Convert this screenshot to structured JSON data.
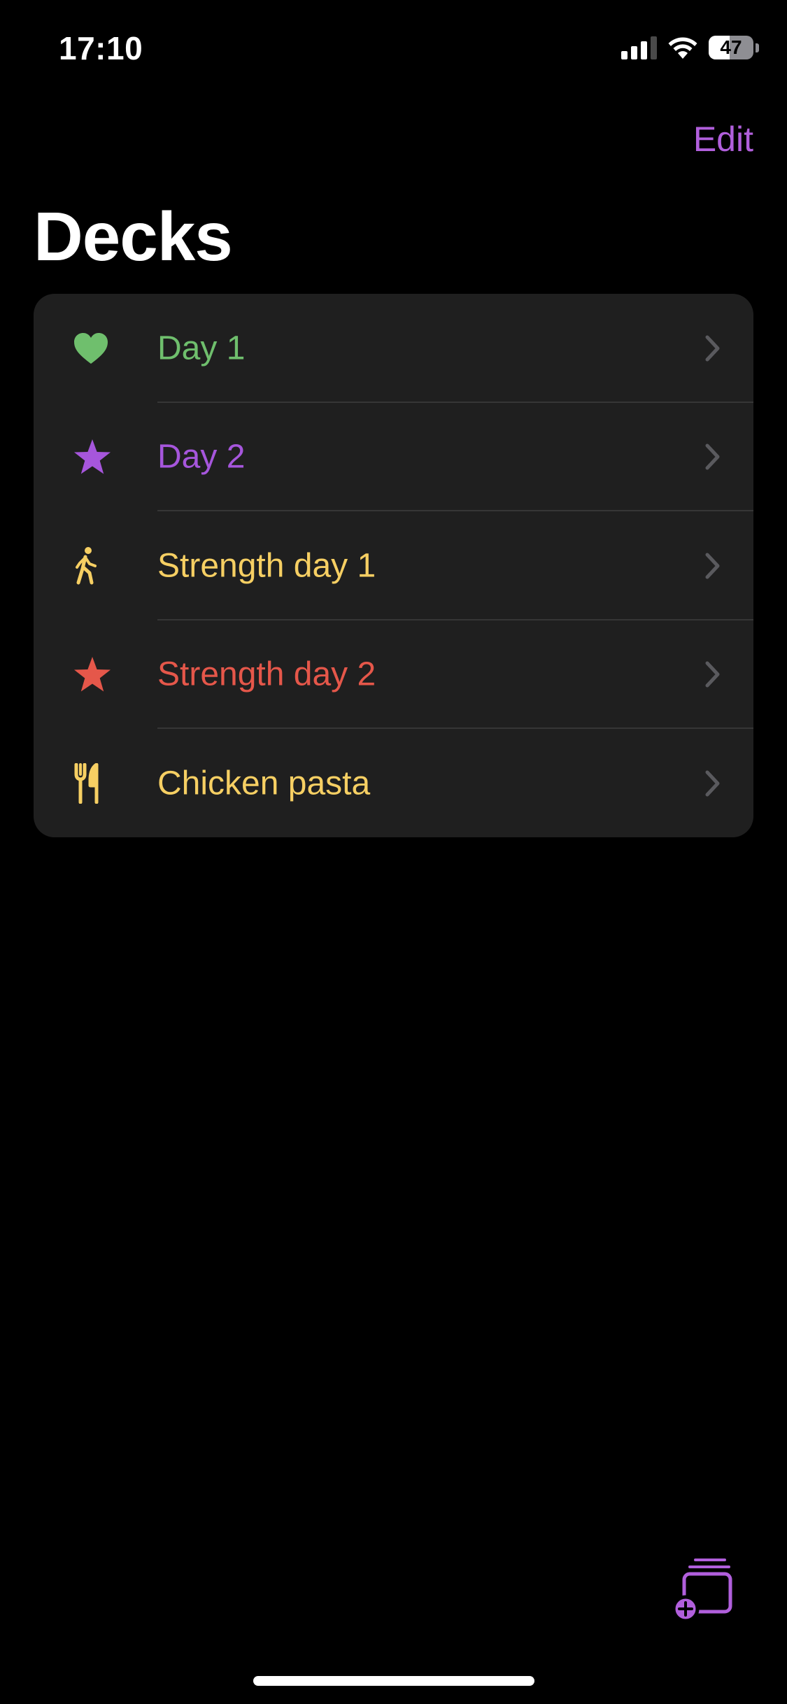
{
  "status_bar": {
    "time": "17:10",
    "battery_level": "47",
    "battery_fraction": 0.47,
    "signal_bars_active": 3,
    "signal_bars_total": 4,
    "icons": [
      "cellular-signal-icon",
      "wifi-icon",
      "battery-icon"
    ]
  },
  "nav": {
    "edit_label": "Edit",
    "title": "Decks"
  },
  "colors": {
    "accent": "#b15fdc",
    "background": "#000000",
    "card": "#1f1f1f",
    "chevron": "#5a5a5e"
  },
  "decks": [
    {
      "label": "Day 1",
      "icon": "heart-icon",
      "color": "#6fbf6d"
    },
    {
      "label": "Day 2",
      "icon": "star-icon",
      "color": "#a656dc"
    },
    {
      "label": "Strength day 1",
      "icon": "walking-person-icon",
      "color": "#f6cf63"
    },
    {
      "label": "Strength day 2",
      "icon": "star-icon",
      "color": "#e5574a"
    },
    {
      "label": "Chicken pasta",
      "icon": "fork-knife-icon",
      "color": "#f6cf63"
    }
  ],
  "toolbar": {
    "add_deck_icon": "add-deck-icon"
  }
}
